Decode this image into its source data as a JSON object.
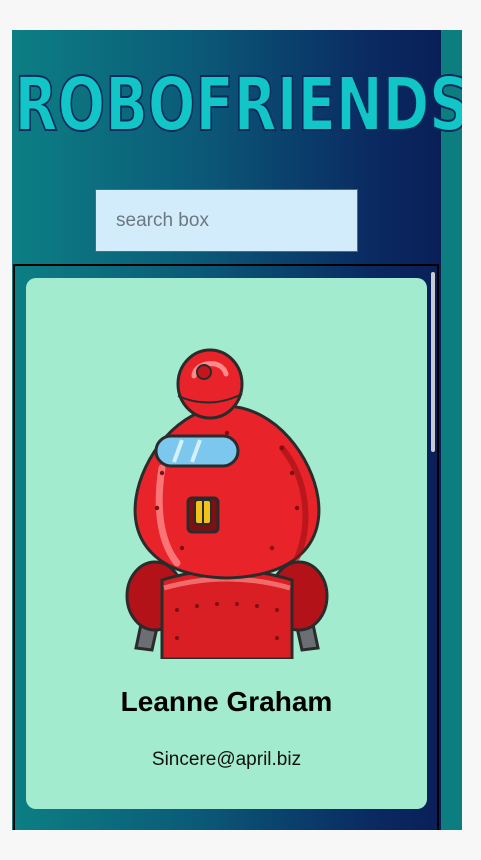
{
  "app": {
    "title": "ROBOFRIENDS"
  },
  "search": {
    "placeholder": "search box",
    "value": ""
  },
  "cards": [
    {
      "name": "Leanne Graham",
      "email": "Sincere@april.biz",
      "avatar_icon": "red-robot-avatar"
    }
  ],
  "colors": {
    "title": "#12c5c7",
    "title_outline": "#0a2a5c",
    "card_bg": "#a2ebcf",
    "search_bg": "#d3ecfb"
  }
}
